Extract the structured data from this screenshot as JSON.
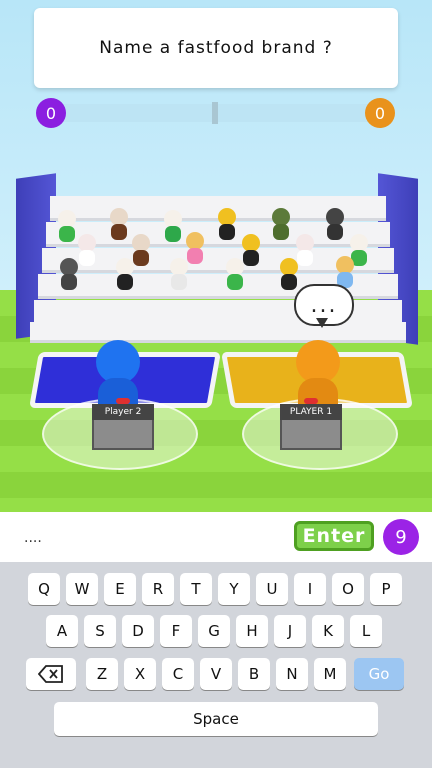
{
  "question": "Name a fastfood brand ?",
  "scores": {
    "left": "0",
    "right": "0"
  },
  "players": {
    "left_label": "Player 2",
    "right_label": "PLAYER 1"
  },
  "bubble": {
    "text": "..."
  },
  "input": {
    "value": "....",
    "placeholder": ""
  },
  "enter_label": "Enter",
  "timer": "9",
  "keyboard": {
    "row1": [
      "Q",
      "W",
      "E",
      "R",
      "T",
      "Y",
      "U",
      "I",
      "O",
      "P"
    ],
    "row2": [
      "A",
      "S",
      "D",
      "F",
      "G",
      "H",
      "J",
      "K",
      "L"
    ],
    "row3": [
      "Z",
      "X",
      "C",
      "V",
      "B",
      "N",
      "M"
    ],
    "go_label": "Go",
    "space_label": "Space"
  },
  "colors": {
    "left_accent": "#8b1ee0",
    "right_accent": "#e9921c",
    "enter": "#7dd04a",
    "timer": "#9b23e6"
  }
}
